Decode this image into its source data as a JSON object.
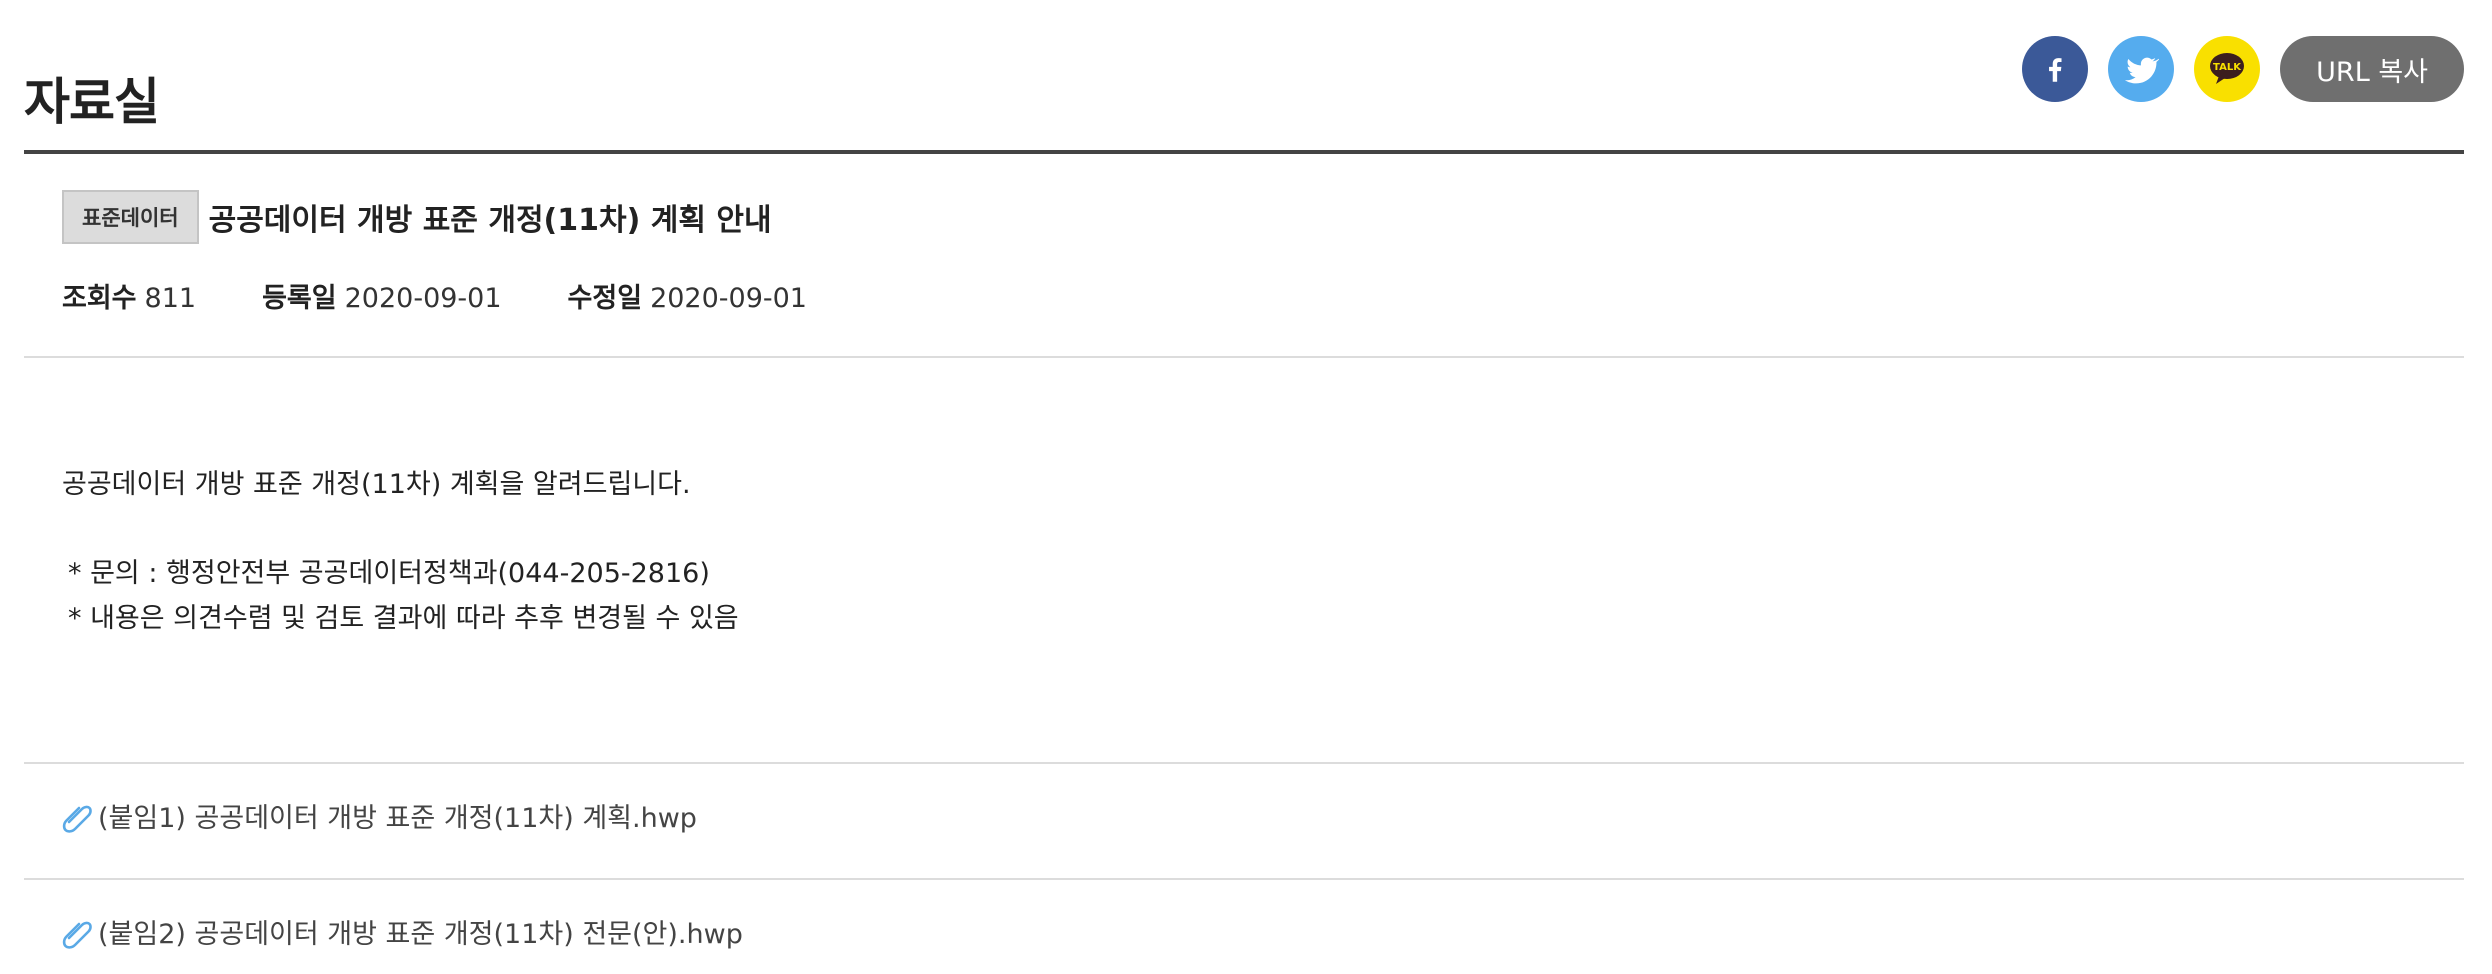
{
  "header": {
    "title": "자료실",
    "share": {
      "facebook_icon": "facebook-icon",
      "twitter_icon": "twitter-icon",
      "kakao_icon": "kakaotalk-icon",
      "kakao_label": "TALK",
      "url_copy_label": "URL 복사"
    }
  },
  "post": {
    "category": "표준데이터",
    "title": "공공데이터 개방 표준 개정(11차) 계획 안내",
    "meta": {
      "views_label": "조회수",
      "views_value": "811",
      "registered_label": "등록일",
      "registered_value": "2020-09-01",
      "modified_label": "수정일",
      "modified_value": "2020-09-01"
    },
    "body": {
      "intro": "공공데이터 개방 표준 개정(11차) 계획을 알려드립니다.",
      "contact": "* 문의 : 행정안전부 공공데이터정책과(044-205-2816)",
      "notice": "* 내용은 의견수렴 및 검토 결과에 따라 추후 변경될 수 있음"
    },
    "attachments": [
      {
        "name": "(붙임1) 공공데이터 개방 표준 개정(11차) 계획.hwp",
        "icon": "paperclip-icon"
      },
      {
        "name": "(붙임2) 공공데이터 개방 표준 개정(11차) 전문(안).hwp",
        "icon": "paperclip-icon"
      }
    ]
  },
  "colors": {
    "facebook": "#3b5998",
    "twitter": "#55acee",
    "kakao": "#f9e000",
    "url_button": "#6f6f6f",
    "attachment_clip": "#5aa9e6"
  }
}
